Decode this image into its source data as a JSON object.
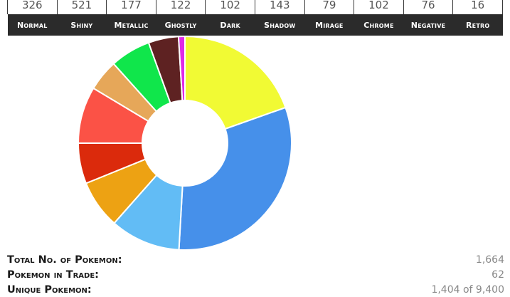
{
  "type_counts": [
    {
      "count": "326",
      "label": "Normal"
    },
    {
      "count": "521",
      "label": "Shiny"
    },
    {
      "count": "177",
      "label": "Metallic"
    },
    {
      "count": "122",
      "label": "Ghostly"
    },
    {
      "count": "102",
      "label": "Dark"
    },
    {
      "count": "143",
      "label": "Shadow"
    },
    {
      "count": "79",
      "label": "Mirage"
    },
    {
      "count": "102",
      "label": "Chrome"
    },
    {
      "count": "76",
      "label": "Negative"
    },
    {
      "count": "16",
      "label": "Retro"
    }
  ],
  "chart_data": {
    "type": "pie",
    "categories": [
      "Normal",
      "Shiny",
      "Metallic",
      "Ghostly",
      "Dark",
      "Shadow",
      "Mirage",
      "Chrome",
      "Negative",
      "Retro"
    ],
    "values": [
      326,
      521,
      177,
      122,
      102,
      143,
      79,
      102,
      76,
      16
    ],
    "colors": [
      "#f1fa34",
      "#4690ea",
      "#62bcf5",
      "#eda213",
      "#db2a0c",
      "#fb5246",
      "#e6a759",
      "#10e64b",
      "#5e2222",
      "#e02ae8"
    ],
    "donut": true,
    "title": ""
  },
  "stats": [
    {
      "label": "Total No. of Pokemon:",
      "value": "1,664"
    },
    {
      "label": "Pokemon in Trade:",
      "value": "62"
    },
    {
      "label": "Unique Pokemon:",
      "value": "1,404 of 9,400"
    }
  ]
}
